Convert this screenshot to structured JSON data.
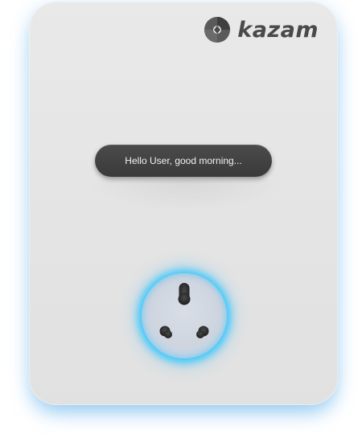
{
  "brand": {
    "name": "kazam",
    "logo_icon": "kazam-logo-mark-icon"
  },
  "display": {
    "message": "Hello User, good morning..."
  },
  "socket": {
    "icon": "power-socket-icon",
    "glow_color": "#3cc8ff",
    "status": "active"
  },
  "colors": {
    "device_body": "#e6e6e6",
    "display_bg": "#404040",
    "display_text": "#f2f2f2",
    "logo_text": "#4a4a4a",
    "accent_glow": "#3cc8ff"
  }
}
